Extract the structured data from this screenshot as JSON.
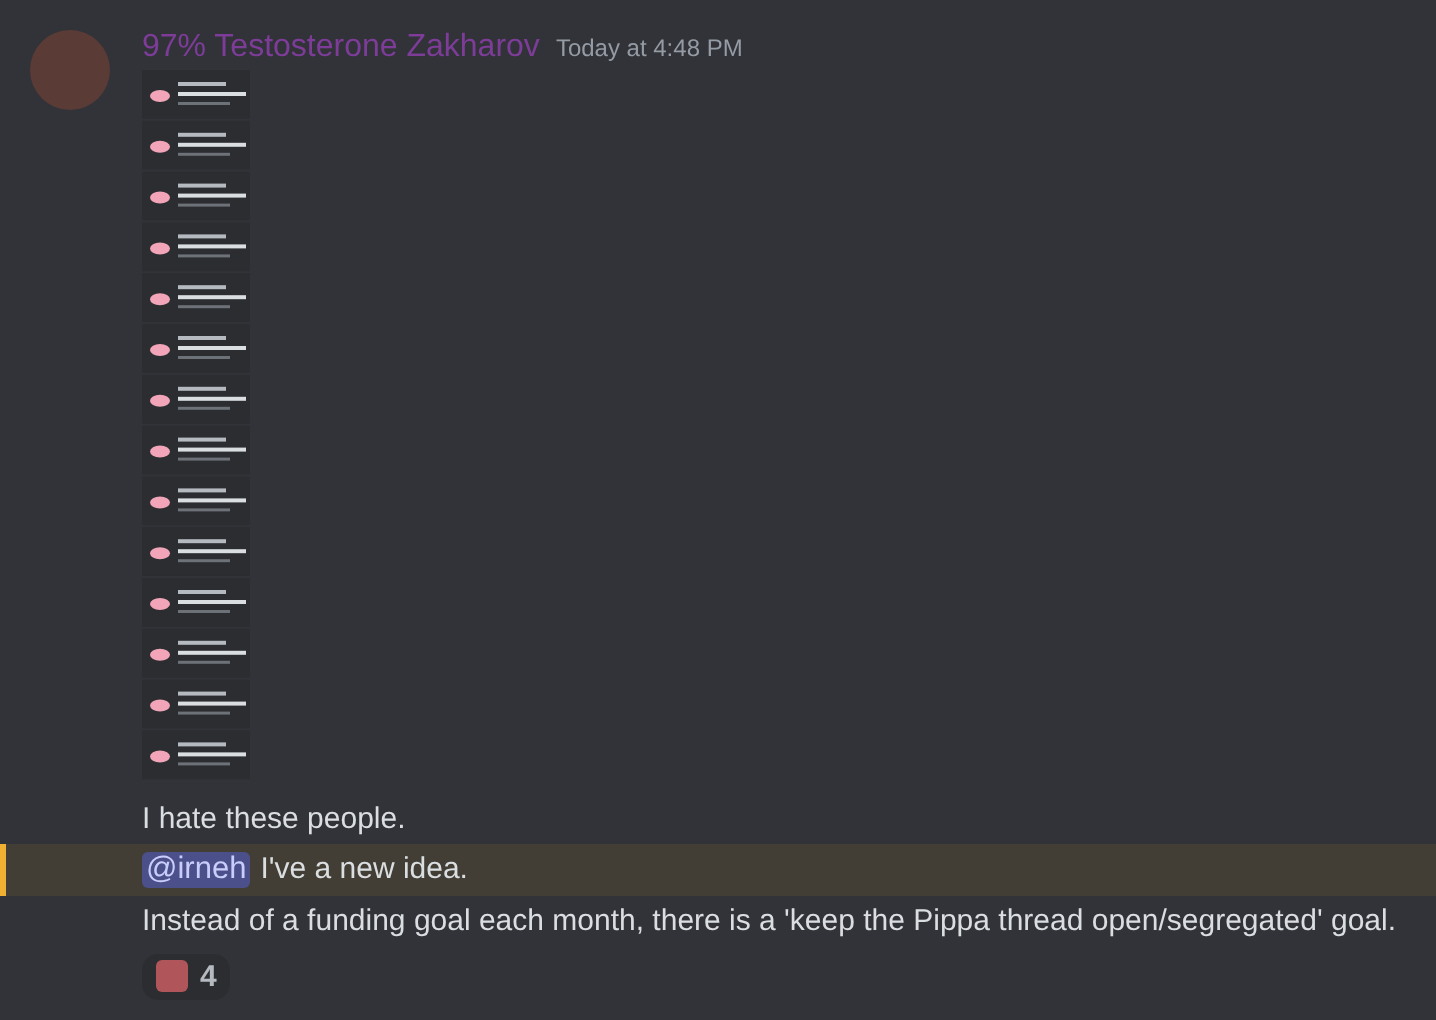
{
  "author": {
    "name": "97% Testosterone Zakharov",
    "timestamp": "Today at 4:48 PM"
  },
  "lines": [
    {
      "text": "I hate these people.",
      "highlighted": false
    },
    {
      "mention": "@irneh",
      "text": "I've a new idea.",
      "highlighted": true
    },
    {
      "text": "Instead of a funding goal each month, there is a 'keep the Pippa thread open/segregated' goal.",
      "highlighted": false
    }
  ],
  "reaction": {
    "count": "4"
  }
}
